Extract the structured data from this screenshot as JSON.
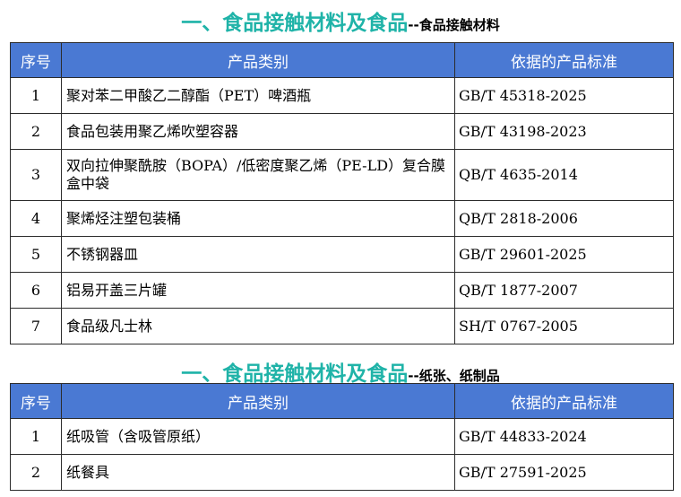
{
  "sections": [
    {
      "title_main": "一、食品接触材料及食品",
      "title_sub": "--食品接触材料",
      "headers": [
        "序号",
        "产品类别",
        "依据的产品标准"
      ],
      "rows": [
        {
          "index": "1",
          "category": "聚对苯二甲酸乙二醇酯（PET）啤酒瓶",
          "standard": "GB/T 45318-2025"
        },
        {
          "index": "2",
          "category": "食品包装用聚乙烯吹塑容器",
          "standard": "GB/T 43198-2023"
        },
        {
          "index": "3",
          "category": "双向拉伸聚酰胺（BOPA）/低密度聚乙烯（PE-LD）复合膜盒中袋",
          "standard": "QB/T 4635-2014"
        },
        {
          "index": "4",
          "category": "聚烯烃注塑包装桶",
          "standard": "QB/T 2818-2006"
        },
        {
          "index": "5",
          "category": "不锈钢器皿",
          "standard": "GB/T 29601-2025"
        },
        {
          "index": "6",
          "category": "铝易开盖三片罐",
          "standard": "QB/T 1877-2007"
        },
        {
          "index": "7",
          "category": "食品级凡士林",
          "standard": "SH/T 0767-2005"
        }
      ]
    },
    {
      "title_main": "一、食品接触材料及食品",
      "title_sub": "--纸张、纸制品",
      "headers": [
        "序号",
        "产品类别",
        "依据的产品标准"
      ],
      "rows": [
        {
          "index": "1",
          "category": "纸吸管（含吸管原纸）",
          "standard": "GB/T 44833-2024"
        },
        {
          "index": "2",
          "category": "纸餐具",
          "standard": "GB/T 27591-2025"
        }
      ]
    }
  ]
}
